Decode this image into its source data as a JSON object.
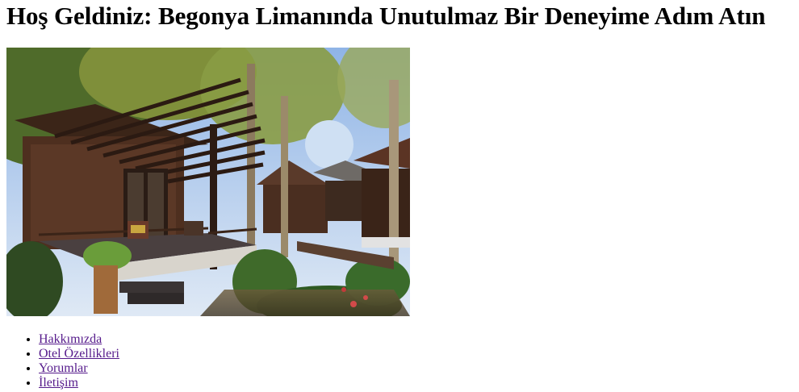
{
  "page": {
    "heading": "Hoş Geldiniz: Begonya Limanında Unutulmaz Bir Deneyime Adım Atın"
  },
  "hero_image": {
    "description_icon": "resort-bungalow-image"
  },
  "nav": {
    "items": [
      {
        "label": "Hakkımızda"
      },
      {
        "label": "Otel Özellikleri"
      },
      {
        "label": "Yorumlar"
      },
      {
        "label": "İletişim"
      }
    ],
    "link_color": "#551a8b"
  }
}
